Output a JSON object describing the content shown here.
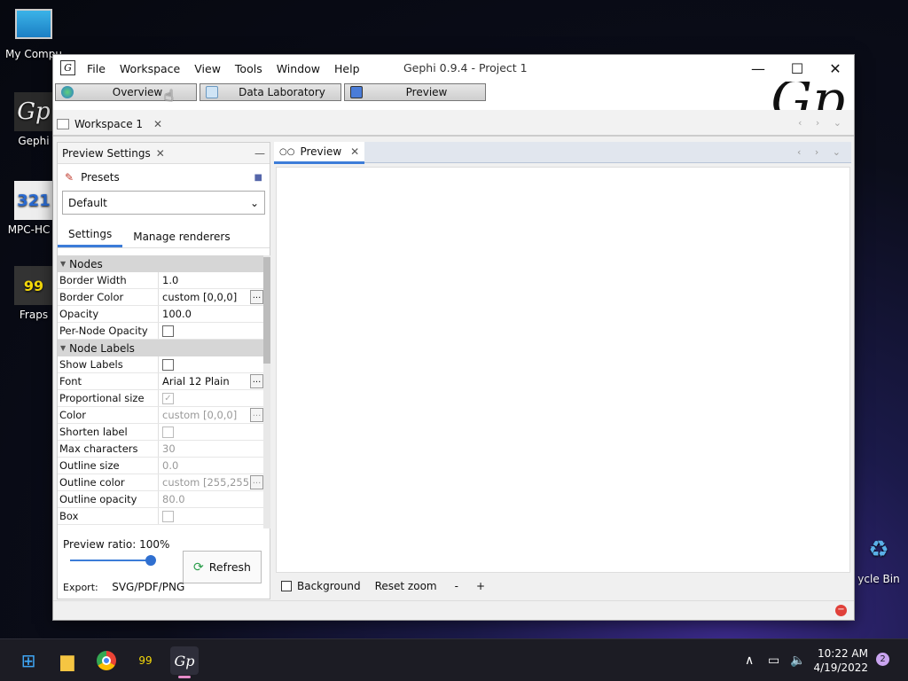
{
  "desktop": {
    "icons": [
      {
        "label": "My Compu",
        "glyph": "monitor-icon"
      },
      {
        "label": "Gephi",
        "glyph": "gephi-icon"
      },
      {
        "label": "MPC-HC x",
        "glyph": "mpc-hc-icon"
      },
      {
        "label": "Fraps",
        "glyph": "fraps-icon"
      },
      {
        "label": "ycle Bin",
        "glyph": "recycle-bin-icon"
      }
    ]
  },
  "window": {
    "title": "Gephi 0.9.4 - Project 1",
    "menu": [
      "File",
      "Workspace",
      "View",
      "Tools",
      "Window",
      "Help"
    ],
    "perspectives": [
      "Overview",
      "Data Laboratory",
      "Preview"
    ],
    "workspace_tab": "Workspace 1"
  },
  "preview_settings": {
    "panel_title": "Preview Settings",
    "presets_label": "Presets",
    "preset_value": "Default",
    "tabs": [
      "Settings",
      "Manage renderers"
    ],
    "sections": [
      {
        "name": "Nodes",
        "rows": [
          {
            "key": "Border Width",
            "value": "1.0"
          },
          {
            "key": "Border Color",
            "value": "custom [0,0,0]"
          },
          {
            "key": "Opacity",
            "value": "100.0"
          },
          {
            "key": "Per-Node Opacity",
            "checked": false
          }
        ]
      },
      {
        "name": "Node Labels",
        "rows": [
          {
            "key": "Show Labels",
            "checked": false
          },
          {
            "key": "Font",
            "value": "Arial 12 Plain"
          },
          {
            "key": "Proportional size",
            "checked": true
          },
          {
            "key": "Color",
            "value": "custom [0,0,0]"
          },
          {
            "key": "Shorten label",
            "checked": false
          },
          {
            "key": "Max characters",
            "value": "30"
          },
          {
            "key": "Outline size",
            "value": "0.0"
          },
          {
            "key": "Outline color",
            "value": "custom [255,255..."
          },
          {
            "key": "Outline opacity",
            "value": "80.0"
          },
          {
            "key": "Box",
            "checked": false
          }
        ]
      }
    ],
    "ratio_label": "Preview ratio:",
    "ratio_value": "100%",
    "ratio_fraction": 1.0,
    "refresh_label": "Refresh",
    "export_label": "Export:",
    "export_formats": "SVG/PDF/PNG"
  },
  "preview_panel": {
    "tab_label": "Preview",
    "background_label": "Background",
    "reset_zoom_label": "Reset zoom",
    "zoom_out": "-",
    "zoom_in": "+"
  },
  "taskbar": {
    "time": "10:22 AM",
    "date": "4/19/2022",
    "notifications": "2"
  },
  "colors": {
    "accent": "#3c7cd8",
    "error": "#e0403a"
  }
}
